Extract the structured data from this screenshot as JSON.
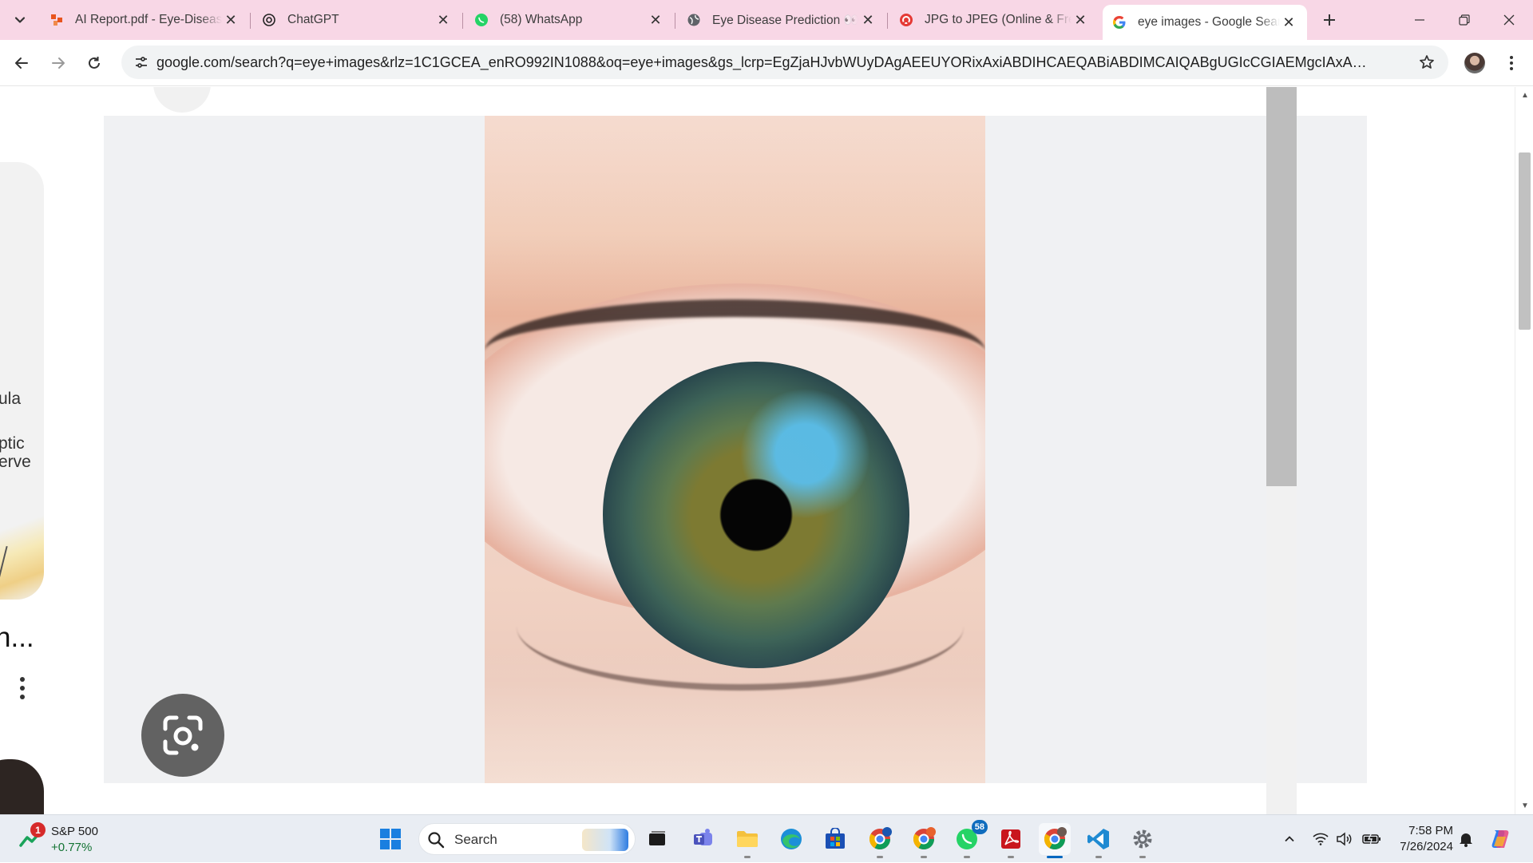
{
  "browser": {
    "tabs": [
      {
        "title": "AI Report.pdf - Eye-Disease",
        "favicon": "report-favicon",
        "active": false
      },
      {
        "title": "ChatGPT",
        "favicon": "chatgpt-favicon",
        "active": false
      },
      {
        "title": "(58) WhatsApp",
        "favicon": "whatsapp-favicon",
        "active": false
      },
      {
        "title": "Eye Disease Prediction 👀",
        "favicon": "globe-favicon",
        "active": false
      },
      {
        "title": "JPG to JPEG (Online & Free",
        "favicon": "converter-favicon",
        "active": false
      },
      {
        "title": "eye images - Google Search",
        "favicon": "google-favicon",
        "active": true
      }
    ],
    "address": "google.com/search?q=eye+images&rlz=1C1GCEA_enRO992IN1088&oq=eye+images&gs_lcrp=EgZjaHJvbWUyDAgAEEUYORixAxiABDIHCAEQABiABDIMCAIQABgUGIcCGIAEMgcIAxAAGIAEMgcIBBAAGI..."
  },
  "page": {
    "left_fragments": {
      "label_1": "ula",
      "label_2": "ptic",
      "label_3": "erve",
      "title_fragment": "n..."
    },
    "preview": {
      "image_subject": "close-up of a green-blue human eye"
    }
  },
  "taskbar": {
    "widget": {
      "name": "S&P 500",
      "change": "+0.77%",
      "badge": "1"
    },
    "search_placeholder": "Search",
    "whatsapp_badge": "58",
    "clock_time": "7:58 PM",
    "clock_date": "7/26/2024"
  },
  "colors": {
    "tabstrip": "#f8d7e6",
    "omnibox": "#f1f3f4",
    "stage": "#f0f1f3",
    "taskbar": "#e9edf3",
    "positive_change": "#137333"
  }
}
